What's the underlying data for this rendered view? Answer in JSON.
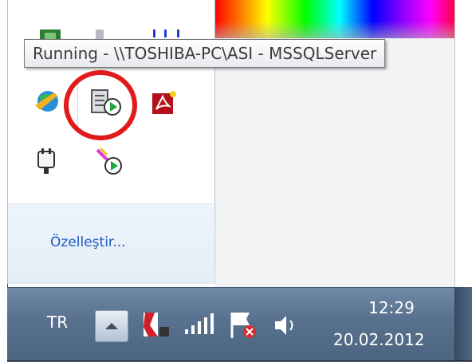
{
  "tooltip": {
    "text": "Running - \\\\TOSHIBA-PC\\ASI - MSSQLServer"
  },
  "tray_popup": {
    "customize_label": "Özelleştir...",
    "icons": [
      "network-globe-icon",
      "sql-server-service-manager-icon",
      "adobe-acrobat-icon",
      "power-plug-icon",
      "sql-server-agent-icon"
    ]
  },
  "taskbar": {
    "language": "TR",
    "show_hidden_icons": "chevron-up-icon",
    "icons": [
      "kaspersky-icon",
      "signal-strength-icon",
      "action-center-flag-icon",
      "volume-icon"
    ],
    "clock_time": "12:29",
    "clock_date": "20.02.2012"
  },
  "colors": {
    "highlight_ring": "#e11b1b",
    "link": "#1e5bbf",
    "taskbar": "#58728f"
  }
}
